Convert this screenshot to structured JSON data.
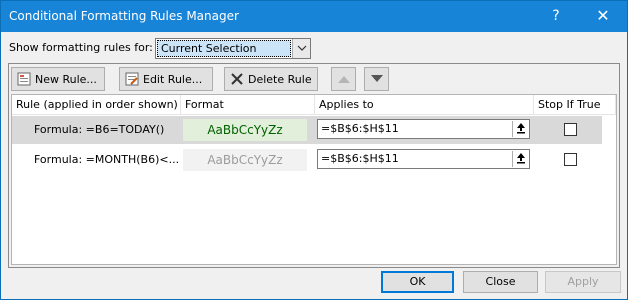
{
  "window": {
    "title": "Conditional Formatting Rules Manager",
    "help_glyph": "?",
    "close_glyph": "✕"
  },
  "show_rules": {
    "label": "Show formatting rules for:",
    "selected": "Current Selection"
  },
  "toolbar": {
    "new_rule": "New Rule...",
    "edit_rule": "Edit Rule...",
    "delete_rule": "Delete Rule"
  },
  "table": {
    "headers": {
      "rule": "Rule (applied in order shown)",
      "format": "Format",
      "applies_to": "Applies to",
      "stop_if_true": "Stop If True"
    },
    "rows": [
      {
        "rule": "Formula: =B6=TODAY()",
        "format_preview": "AaBbCcYyZz",
        "applies_to": "=$B$6:$H$11",
        "stop_if_true": false,
        "selected": true
      },
      {
        "rule": "Formula: =MONTH(B6)<...",
        "format_preview": "AaBbCcYyZz",
        "applies_to": "=$B$6:$H$11",
        "stop_if_true": false,
        "selected": false
      }
    ]
  },
  "footer": {
    "ok": "OK",
    "close": "Close",
    "apply": "Apply"
  },
  "colors": {
    "titlebar": "#1784d8",
    "format_preview_1_bg": "#e2efda",
    "format_preview_1_text": "#006100",
    "selected_row": "#d9d9d9"
  }
}
